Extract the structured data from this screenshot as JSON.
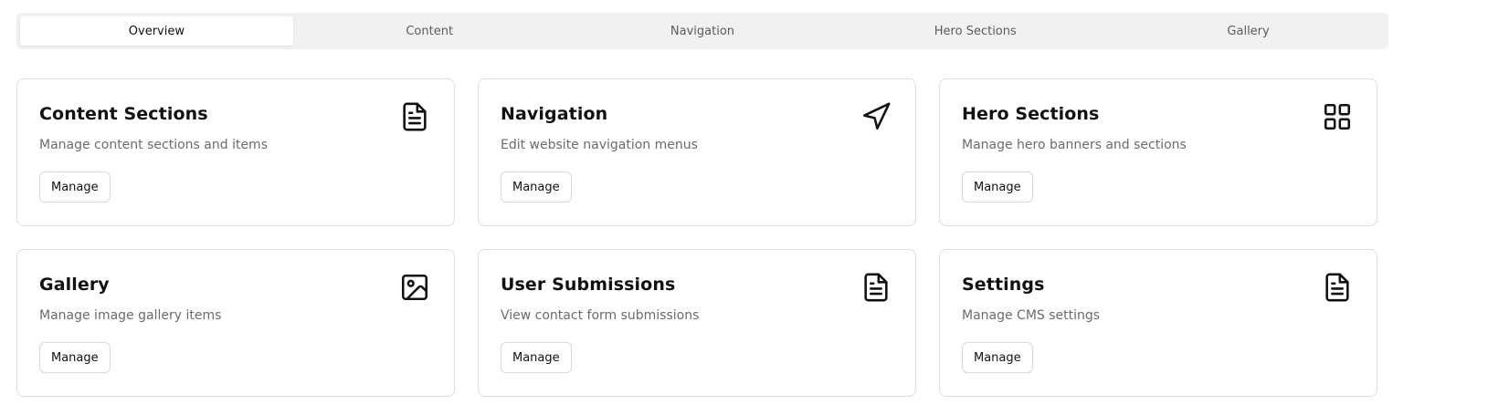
{
  "tabs": [
    {
      "label": "Overview",
      "active": true
    },
    {
      "label": "Content",
      "active": false
    },
    {
      "label": "Navigation",
      "active": false
    },
    {
      "label": "Hero Sections",
      "active": false
    },
    {
      "label": "Gallery",
      "active": false
    }
  ],
  "cards": [
    {
      "title": "Content Sections",
      "description": "Manage content sections and items",
      "button": "Manage",
      "icon": "file-text-icon"
    },
    {
      "title": "Navigation",
      "description": "Edit website navigation menus",
      "button": "Manage",
      "icon": "send-arrow-icon"
    },
    {
      "title": "Hero Sections",
      "description": "Manage hero banners and sections",
      "button": "Manage",
      "icon": "layout-grid-icon"
    },
    {
      "title": "Gallery",
      "description": "Manage image gallery items",
      "button": "Manage",
      "icon": "image-icon"
    },
    {
      "title": "User Submissions",
      "description": "View contact form submissions",
      "button": "Manage",
      "icon": "file-text-icon"
    },
    {
      "title": "Settings",
      "description": "Manage CMS settings",
      "button": "Manage",
      "icon": "file-text-icon"
    }
  ],
  "colors": {
    "tab_bar_bg": "#f1f1f1",
    "active_tab_bg": "#ffffff",
    "card_border": "#dedede",
    "muted_text": "#6b6b6b"
  }
}
